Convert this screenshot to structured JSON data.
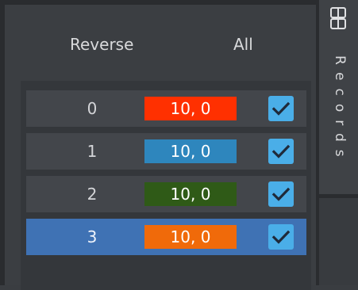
{
  "header": {
    "reverse_label": "Reverse",
    "all_label": "All"
  },
  "records": [
    {
      "index": "0",
      "value": "10, 0",
      "color": "#ff3000",
      "checked": true,
      "selected": false
    },
    {
      "index": "1",
      "value": "10, 0",
      "color": "#2e86bd",
      "checked": true,
      "selected": false
    },
    {
      "index": "2",
      "value": "10, 0",
      "color": "#2f5a17",
      "checked": true,
      "selected": false
    },
    {
      "index": "3",
      "value": "10, 0",
      "color": "#f06a0a",
      "checked": true,
      "selected": true
    }
  ],
  "sidebar": {
    "tab_label": "Records",
    "tab_icon": "records-panel-icon"
  },
  "colors": {
    "selected_row": "#3f72b4",
    "checkbox": "#4aaee8"
  }
}
